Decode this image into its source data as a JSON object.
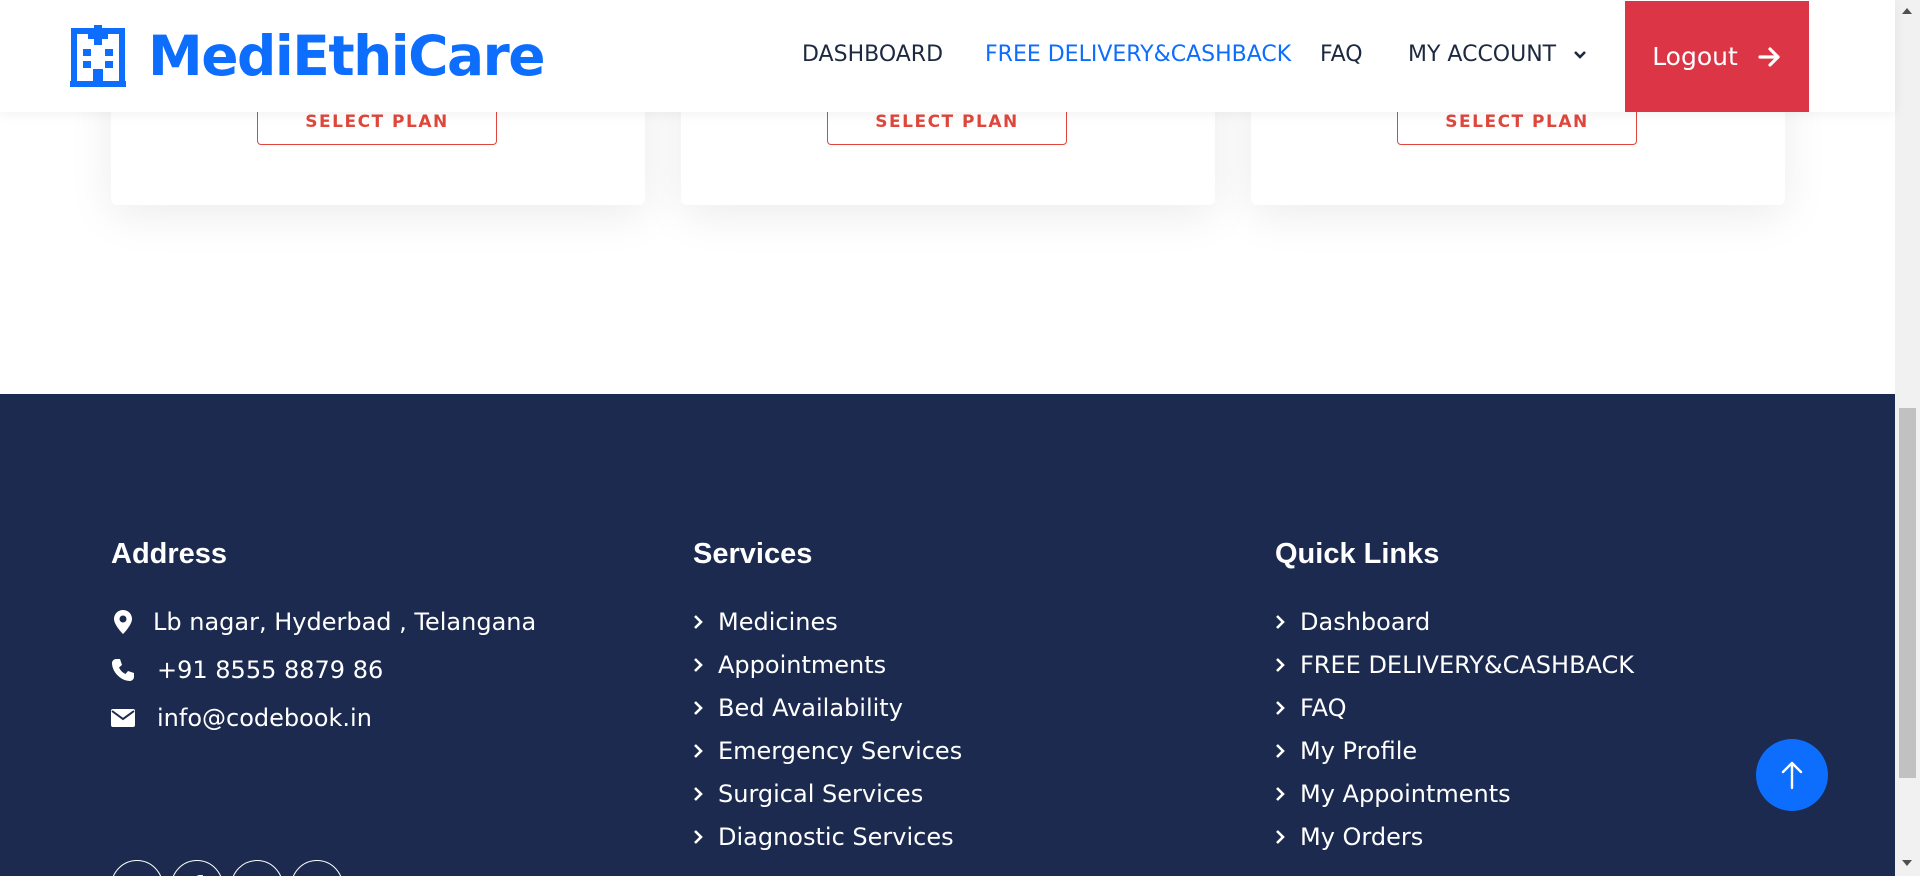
{
  "brand": {
    "name": "MediEthiCare",
    "color": "#0d6efd"
  },
  "nav": {
    "items": [
      {
        "label": "DASHBOARD",
        "active": false
      },
      {
        "label": "FREE DELIVERY&CASHBACK",
        "active": true
      },
      {
        "label": "FAQ",
        "active": false
      },
      {
        "label": "MY ACCOUNT",
        "active": false,
        "has_dropdown": true
      }
    ],
    "logout_label": "Logout",
    "logout_color": "#dc3545"
  },
  "plans": {
    "button_labels": [
      "SELECT PLAN",
      "SELECT PLAN",
      "SELECT PLAN"
    ]
  },
  "footer": {
    "background": "#1b2a4e",
    "address": {
      "heading": "Address",
      "location": "Lb nagar, Hyderbad , Telangana",
      "phone": "+91 8555 8879 86",
      "email": "info@codebook.in",
      "socials": [
        "twitter-icon",
        "facebook-icon",
        "youtube-icon",
        "linkedin-icon"
      ]
    },
    "services": {
      "heading": "Services",
      "items": [
        "Medicines",
        "Appointments",
        "Bed Availability",
        "Emergency Services",
        "Surgical Services",
        "Diagnostic Services"
      ]
    },
    "quick_links": {
      "heading": "Quick Links",
      "items": [
        "Dashboard",
        "FREE DELIVERY&CASHBACK",
        "FAQ",
        "My Profile",
        "My Appointments",
        "My Orders"
      ]
    }
  }
}
